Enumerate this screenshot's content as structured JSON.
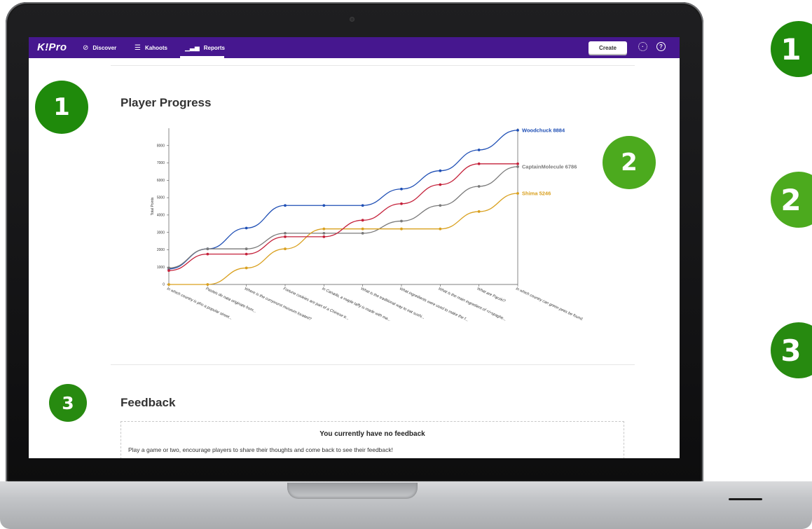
{
  "navbar": {
    "logo": "K!Pro",
    "items": [
      {
        "label": "Discover",
        "icon": "compass-icon"
      },
      {
        "label": "Kahoots",
        "icon": "list-icon"
      },
      {
        "label": "Reports",
        "icon": "bar-chart-icon"
      }
    ],
    "create_label": "Create",
    "settings_icon": "gear-icon",
    "help_icon": "help-icon",
    "color": "#46178f"
  },
  "badges": {
    "screen": [
      "1",
      "2",
      "3"
    ],
    "side": [
      "1",
      "2",
      "3"
    ],
    "colors": [
      "#1f8a0b",
      "#4caa1e",
      "#278a10"
    ]
  },
  "player_progress": {
    "title": "Player Progress"
  },
  "chart_data": {
    "type": "line",
    "ylabel": "Total Points",
    "ylim": [
      0,
      9000
    ],
    "yticks": [
      0,
      1000,
      2000,
      3000,
      4000,
      5000,
      6000,
      7000,
      8000
    ],
    "categories": [
      "In which country is pho a popular street...",
      "Pasteis de nata originate from...",
      "Where is the currywurst museum located?",
      "Fortune cookies are part of a Chinese tr...",
      "In Canada, a maple taffy is made with ma...",
      "What is the traditional way to eat sushi...",
      "What ingredients were used to make the f...",
      "What is the main ingredient of <i>spaghe...",
      "What are Pączki?",
      "In which country can green peas be found."
    ],
    "series": [
      {
        "name": "Woodchuck",
        "final_label": "Woodchuck 8884",
        "color": "#1f4fb5",
        "values": [
          900,
          2050,
          3250,
          4550,
          4550,
          4550,
          5500,
          6550,
          7750,
          8884
        ]
      },
      {
        "name": "CaptainMolecule",
        "final_label": "CaptainMolecule 6786",
        "color": "#7a7a7a",
        "values": [
          950,
          2050,
          2050,
          2950,
          2950,
          2950,
          3650,
          4550,
          5650,
          6786
        ]
      },
      {
        "name": "Shima",
        "final_label": "Shima 5246",
        "color": "#d9a01e",
        "values": [
          0,
          0,
          950,
          2050,
          3200,
          3200,
          3200,
          3200,
          4200,
          5246
        ]
      },
      {
        "name": "",
        "final_label": "",
        "color": "#c4213a",
        "values": [
          800,
          1750,
          1750,
          2750,
          2750,
          3700,
          4650,
          5750,
          6950,
          6950
        ]
      }
    ]
  },
  "feedback": {
    "title": "Feedback",
    "heading": "You currently have no feedback",
    "text": "Play a game or two, encourage players to share their thoughts and come back to see their feedback!"
  }
}
